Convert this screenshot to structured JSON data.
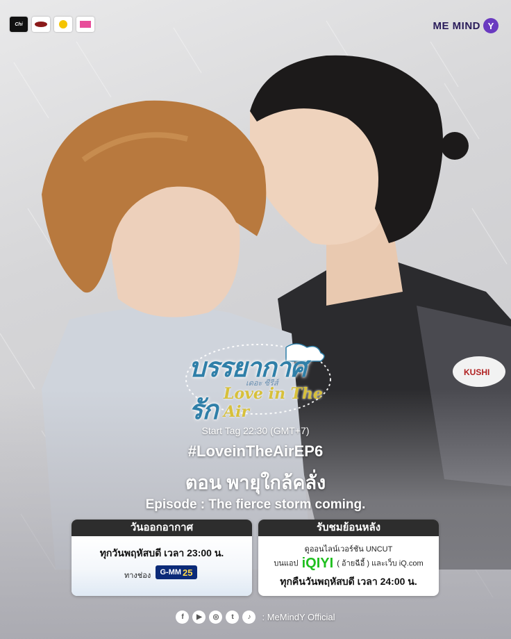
{
  "sponsors": [
    "Chi",
    "",
    "",
    ""
  ],
  "brand": {
    "name": "ME MIND",
    "badge": "Y"
  },
  "logo": {
    "thai_title": "บรรยากาศรัก",
    "thai_sub": "เดอะ ซีรีส์",
    "english_title": "Love in The Air"
  },
  "start_tag": "Start Tag 22:30 (GMT+7)",
  "hashtag": "#LoveinTheAirEP6",
  "episode_thai": "ตอน พายุใกล้คลั่ง",
  "episode_english": "Episode :  The fierce storm coming.",
  "broadcast": {
    "header": "วันออกอากาศ",
    "schedule": "ทุกวันพฤหัสบดี เวลา 23:00 น.",
    "channel_label": "ทางช่อง",
    "channel_name": "G-MM",
    "channel_number": "25"
  },
  "rewatch": {
    "header": "รับชมย้อนหลัง",
    "line1": "ดูออนไลน์เวอร์ชัน UNCUT",
    "app_prefix": "บนแอป",
    "app_name": "iQIYI",
    "app_suffix": "( อ้ายฉีอี้ ) และเว็บ iQ.com",
    "schedule": "ทุกคืนวันพฤหัสบดี เวลา 24:00 น."
  },
  "social": {
    "handle": ": MeMindY Official"
  },
  "colors": {
    "accent_purple": "#6a3ac0",
    "iqiyi_green": "#1fbf1f",
    "card_header": "#2d2d2d"
  }
}
